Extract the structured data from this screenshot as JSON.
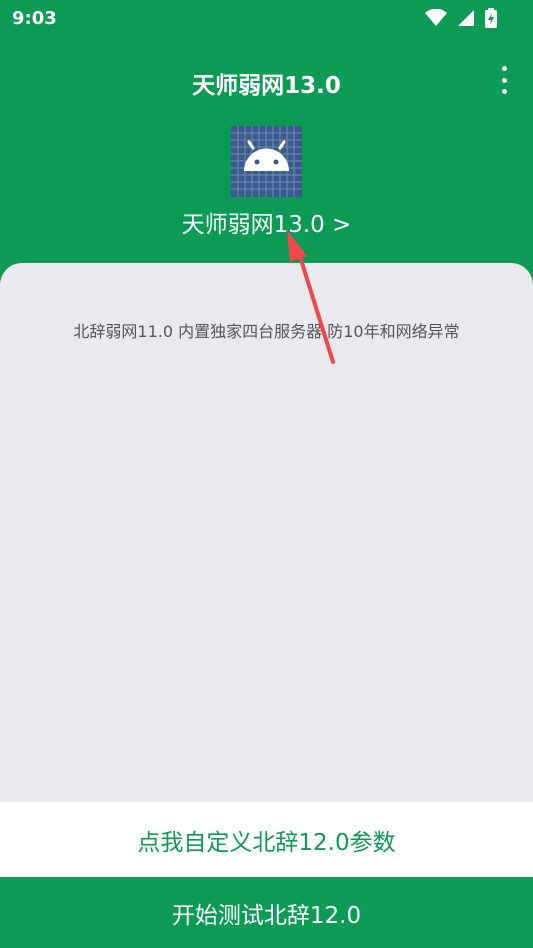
{
  "status_bar": {
    "time": "9:03",
    "icons": [
      "wifi-icon",
      "signal-icon",
      "battery-charging-icon"
    ]
  },
  "app_bar": {
    "title": "天师弱网13.0",
    "menu_icon": "more-vert-icon"
  },
  "header": {
    "logo_icon": "android-icon",
    "link_label": "天师弱网13.0 >"
  },
  "content": {
    "description": "北辞弱网11.0 内置独家四台服务器 防10年和网络异常"
  },
  "actions": {
    "custom_params_label": "点我自定义北辞12.0参数",
    "start_test_label": "开始测试北辞12.0"
  },
  "colors": {
    "primary": "#0b9b55",
    "card_bg": "#e9e9ee",
    "logo_bg": "#3a5b8c",
    "annotation_arrow": "#f0474c"
  }
}
